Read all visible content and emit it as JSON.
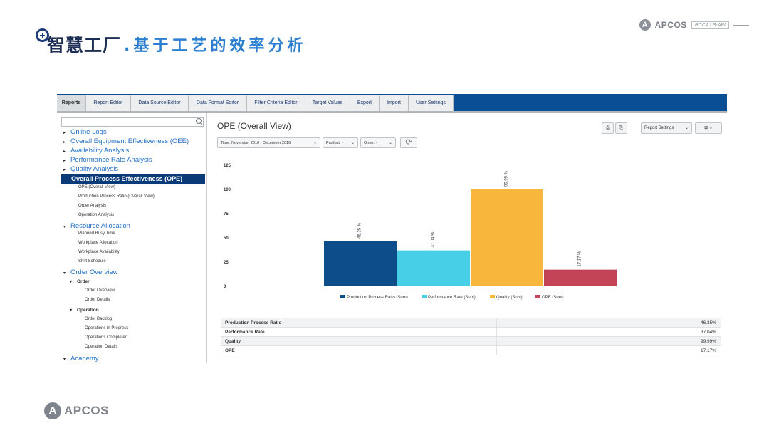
{
  "slide": {
    "title_main": "智慧工厂",
    "title_sub": ".基于工艺的效率分析",
    "brand_name": "APCOS",
    "brand_tag": "BCCA | S-API",
    "footer_brand": "APCOS"
  },
  "tabs": [
    "Reports",
    "Report Editor",
    "Data Source Editor",
    "Data Format Editor",
    "Filter Criteria Editor",
    "Target Values",
    "Export",
    "Import",
    "User Settings"
  ],
  "sidebar": {
    "items": [
      {
        "label": "Online Logs",
        "level": 1,
        "caret": "▸"
      },
      {
        "label": "Overall Equipment Effectiveness (OEE)",
        "level": 1,
        "caret": "▸"
      },
      {
        "label": "Availability Analysis",
        "level": 1,
        "caret": "▸"
      },
      {
        "label": "Performance Rate Analysis",
        "level": 1,
        "caret": "▸"
      },
      {
        "label": "Quality Analysis",
        "level": 1,
        "caret": "▸"
      },
      {
        "label": "Overall Process Effectiveness (OPE)",
        "level": 1,
        "caret": "",
        "selected": true
      },
      {
        "label": "OPE (Overall View)",
        "level": 2
      },
      {
        "label": "Production Process Ratio (Overall View)",
        "level": 2
      },
      {
        "label": "Order Analysis",
        "level": 2
      },
      {
        "label": "Operation Analysis",
        "level": 2
      },
      {
        "label": "Resource Allocation",
        "level": 1,
        "caret": "▾"
      },
      {
        "label": "Planned Busy Time",
        "level": 2
      },
      {
        "label": "Workplace Allocation",
        "level": 2
      },
      {
        "label": "Workplace Availability",
        "level": 2
      },
      {
        "label": "Shift Schedule",
        "level": 2
      },
      {
        "label": "Order Overview",
        "level": 1,
        "caret": "▾"
      },
      {
        "label": "Order",
        "level": 2,
        "caret": "▾",
        "bold": true
      },
      {
        "label": "Order Overview",
        "level": 3
      },
      {
        "label": "Order Details",
        "level": 3
      },
      {
        "label": "Operation",
        "level": 2,
        "caret": "▾",
        "bold": true
      },
      {
        "label": "Order Backlog",
        "level": 3
      },
      {
        "label": "Operations in Progress",
        "level": 3
      },
      {
        "label": "Operations Completed",
        "level": 3
      },
      {
        "label": "Operation Details",
        "level": 3
      },
      {
        "label": "Academy",
        "level": 1,
        "caret": "▾"
      }
    ]
  },
  "main": {
    "title": "OPE (Overall View)",
    "filters": {
      "time": "Time: November 2016 - December 2016",
      "product": "Product: -",
      "order": "Order: -"
    },
    "report_settings": "Report Settings",
    "table": [
      {
        "label": "Production Process Ratio",
        "value": "46.35%"
      },
      {
        "label": "Performance Rate",
        "value": "37.04%"
      },
      {
        "label": "Quality",
        "value": "99.99%"
      },
      {
        "label": "OPE",
        "value": "17.17%"
      }
    ]
  },
  "chart_data": {
    "type": "bar",
    "categories": [
      "Production Process Ratio (Sum)",
      "Performance Rate (Sum)",
      "Quality (Sum)",
      "OPE (Sum)"
    ],
    "values": [
      46.35,
      37.04,
      99.99,
      17.17
    ],
    "data_labels": [
      "46.35 %",
      "37.04 %",
      "99.99 %",
      "17.17 %"
    ],
    "colors": [
      "#0d4d8a",
      "#46cfe6",
      "#f8b73c",
      "#c44457"
    ],
    "yticks": [
      0,
      25,
      50,
      75,
      100,
      125
    ],
    "ylim": [
      0,
      125
    ],
    "legend": "bottom",
    "grid": false
  }
}
